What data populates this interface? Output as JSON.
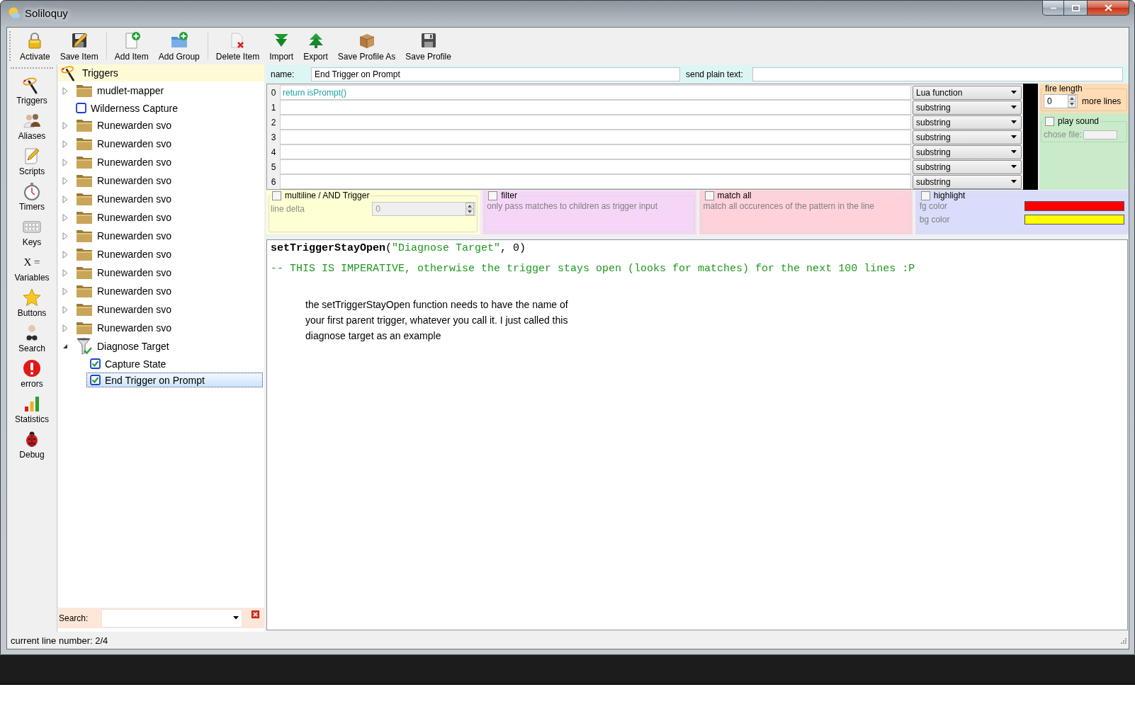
{
  "window": {
    "title": "Soliloquy"
  },
  "toolbar": {
    "groups": [
      [
        {
          "label": "Activate"
        },
        {
          "label": "Save Item"
        }
      ],
      [
        {
          "label": "Add Item"
        },
        {
          "label": "Add Group"
        }
      ],
      [
        {
          "label": "Delete Item"
        },
        {
          "label": "Import"
        },
        {
          "label": "Export"
        },
        {
          "label": "Save Profile As"
        },
        {
          "label": "Save Profile"
        }
      ]
    ]
  },
  "sidebar": {
    "items": [
      {
        "label": "Triggers"
      },
      {
        "label": "Aliases"
      },
      {
        "label": "Scripts"
      },
      {
        "label": "Timers"
      },
      {
        "label": "Keys"
      },
      {
        "label": "Variables",
        "glyph": "X ="
      },
      {
        "label": "Buttons"
      },
      {
        "label": "Search"
      },
      {
        "label": "errors"
      },
      {
        "label": "Statistics"
      },
      {
        "label": "Debug"
      }
    ]
  },
  "tree": {
    "root": "Triggers",
    "items": [
      {
        "label": "mudlet-mapper",
        "kind": "folder",
        "expanded": false,
        "selected": false
      },
      {
        "label": "Wilderness Capture",
        "kind": "trigger",
        "checked": false,
        "selected": false
      },
      {
        "label": "Runewarden svo",
        "kind": "folder",
        "expanded": false,
        "selected": false
      },
      {
        "label": "Runewarden svo",
        "kind": "folder",
        "expanded": false,
        "selected": false
      },
      {
        "label": "Runewarden svo",
        "kind": "folder",
        "expanded": false,
        "selected": false
      },
      {
        "label": "Runewarden svo",
        "kind": "folder",
        "expanded": false,
        "selected": false
      },
      {
        "label": "Runewarden svo",
        "kind": "folder",
        "expanded": false,
        "selected": false
      },
      {
        "label": "Runewarden svo",
        "kind": "folder",
        "expanded": false,
        "selected": false
      },
      {
        "label": "Runewarden svo",
        "kind": "folder",
        "expanded": false,
        "selected": false
      },
      {
        "label": "Runewarden svo",
        "kind": "folder",
        "expanded": false,
        "selected": false
      },
      {
        "label": "Runewarden svo",
        "kind": "folder",
        "expanded": false,
        "selected": false
      },
      {
        "label": "Runewarden svo",
        "kind": "folder",
        "expanded": false,
        "selected": false
      },
      {
        "label": "Runewarden svo",
        "kind": "folder",
        "expanded": false,
        "selected": false
      },
      {
        "label": "Runewarden svo",
        "kind": "folder",
        "expanded": false,
        "selected": false
      },
      {
        "label": "Diagnose Target",
        "kind": "filter",
        "expanded": true,
        "selected": false,
        "children": [
          {
            "label": "Capture State",
            "kind": "trigger",
            "checked": true,
            "selected": false
          },
          {
            "label": "End Trigger on Prompt",
            "kind": "trigger",
            "checked": true,
            "selected": true
          }
        ]
      }
    ]
  },
  "search": {
    "label": "Search:"
  },
  "header_fields": {
    "name_label": "name:",
    "name": "End Trigger on Prompt",
    "plain_text_label": "send plain text:"
  },
  "patterns": [
    {
      "number": "0",
      "text": "return isPrompt()",
      "kind": "lua",
      "type": "Lua function"
    },
    {
      "number": "1",
      "kind": "plain",
      "type": "substring"
    },
    {
      "number": "2",
      "kind": "plain",
      "type": "substring"
    },
    {
      "number": "3",
      "kind": "plain",
      "type": "substring"
    },
    {
      "number": "4",
      "kind": "plain",
      "type": "substring"
    },
    {
      "number": "5",
      "kind": "plain",
      "type": "substring"
    },
    {
      "number": "6",
      "kind": "plain",
      "type": "substring"
    }
  ],
  "fire_length": {
    "title": "fire length",
    "value": "0",
    "suffix": "more lines"
  },
  "play_sound": {
    "label": "play sound",
    "checked": false,
    "file_label": "chose file:",
    "file_disabled": true
  },
  "options": [
    {
      "kind": "multiline",
      "label": "multiline / AND Trigger",
      "checked": false,
      "field_label": "line delta",
      "field_value": "0",
      "field_disabled": true
    },
    {
      "kind": "text",
      "label": "filter",
      "checked": false,
      "description": "only pass matches to children as trigger input"
    },
    {
      "kind": "text",
      "label": "match all",
      "checked": false,
      "description": "match all occurences of the pattern in the line"
    },
    {
      "kind": "colors",
      "label": "highlight",
      "checked": false,
      "colors": [
        {
          "label": "fg color",
          "color": "#ff0000"
        },
        {
          "label": "bg color",
          "color": "#ffff00"
        }
      ]
    }
  ],
  "script": {
    "lines": [
      {
        "parts": [
          {
            "kind": "function",
            "text": "setTriggerStayOpen"
          },
          {
            "kind": "plain",
            "text": "("
          },
          {
            "kind": "string",
            "text": "\"Diagnose Target\""
          },
          {
            "kind": "plain",
            "text": ", 0)"
          }
        ]
      },
      {
        "parts": [
          {
            "kind": "comment",
            "text": "-- THIS IS IMPERATIVE, otherwise the trigger stays open (looks for matches) for the next 100 lines :P"
          }
        ]
      }
    ],
    "note": [
      "the setTriggerStayOpen function needs to have the name of",
      "your first parent trigger, whatever you call it. I just called this",
      "diagnose target as an example"
    ]
  },
  "status_bar": {
    "text": "current line number: 2/4"
  }
}
